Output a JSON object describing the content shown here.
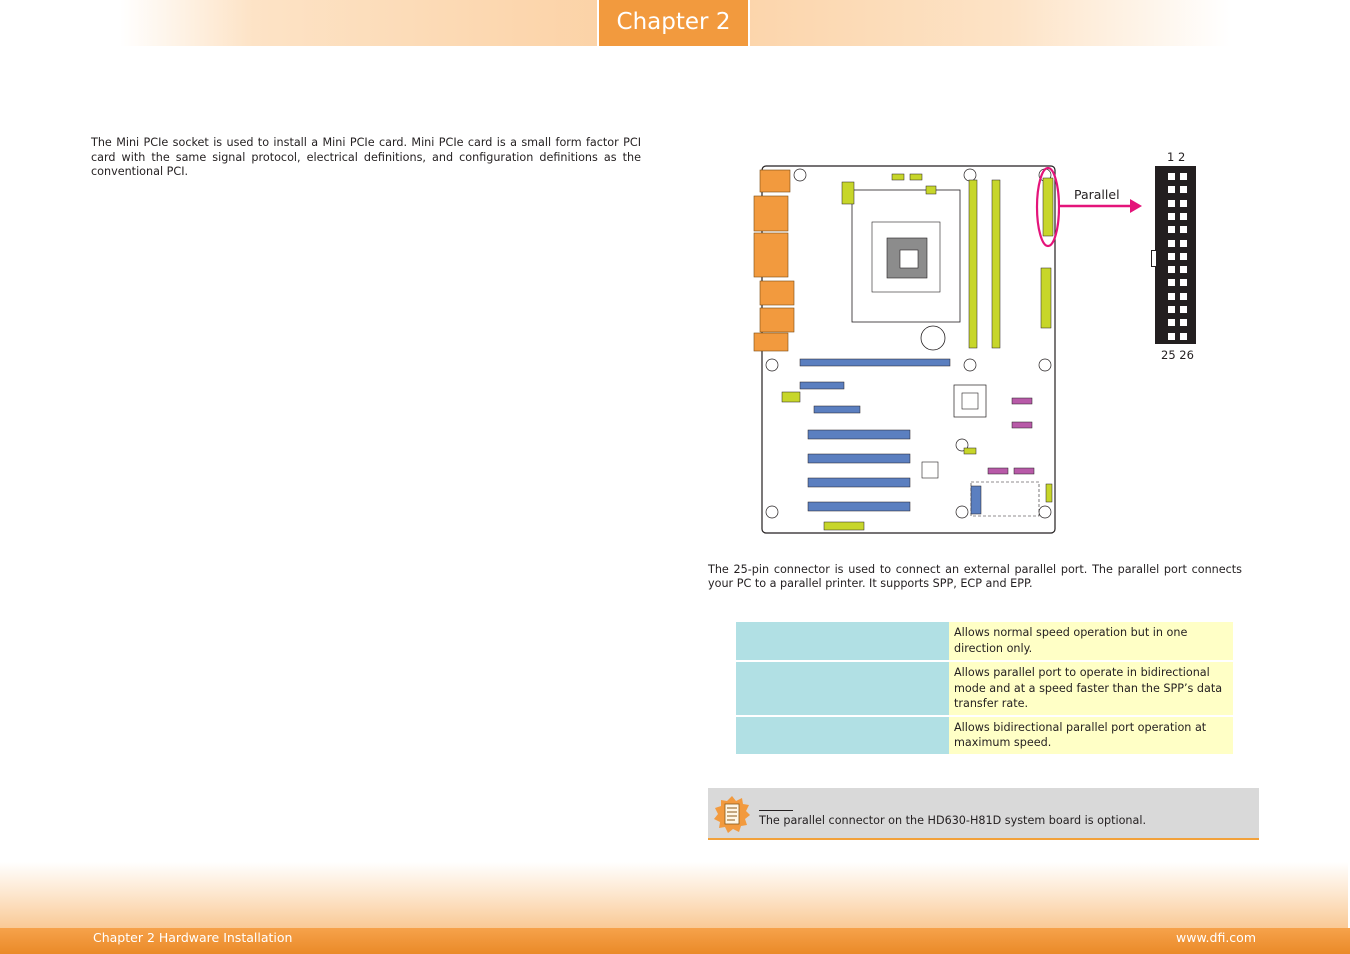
{
  "header": {
    "chapter_tab": "Chapter 2"
  },
  "intro_text": "The Mini PCIe socket is used to install a Mini PCIe card. Mini PCIe card is a small form factor PCI card with the same signal protocol, electrical definitions, and configuration definitions as the conventional PCI.",
  "diagram": {
    "callout_label": "Parallel",
    "pin_top_labels": "1 2",
    "pin_bottom_labels": "25 26",
    "colors": {
      "callout": "#e4147a",
      "connector": "#c7d62a",
      "slot": "#5b7fc0",
      "io_port": "#f29a3e"
    }
  },
  "parallel_description": "The 25-pin connector is used to connect an external parallel port. The parallel port connects your PC to a parallel printer. It supports SPP, ECP and EPP.",
  "modes_table": {
    "rows": [
      {
        "mode": "",
        "description": "Allows normal speed operation but in one direction only."
      },
      {
        "mode": "",
        "description": "Allows parallel port to operate in bidirectional mode and at a speed faster than the SPP’s data transfer rate."
      },
      {
        "mode": "",
        "description": "Allows bidirectional parallel port operation at maximum speed."
      }
    ]
  },
  "note": {
    "icon": "note-icon",
    "text": "The parallel connector on the HD630-H81D system board is optional."
  },
  "footer": {
    "left": "Chapter 2 Hardware Installation",
    "right": "www.dfi.com"
  }
}
